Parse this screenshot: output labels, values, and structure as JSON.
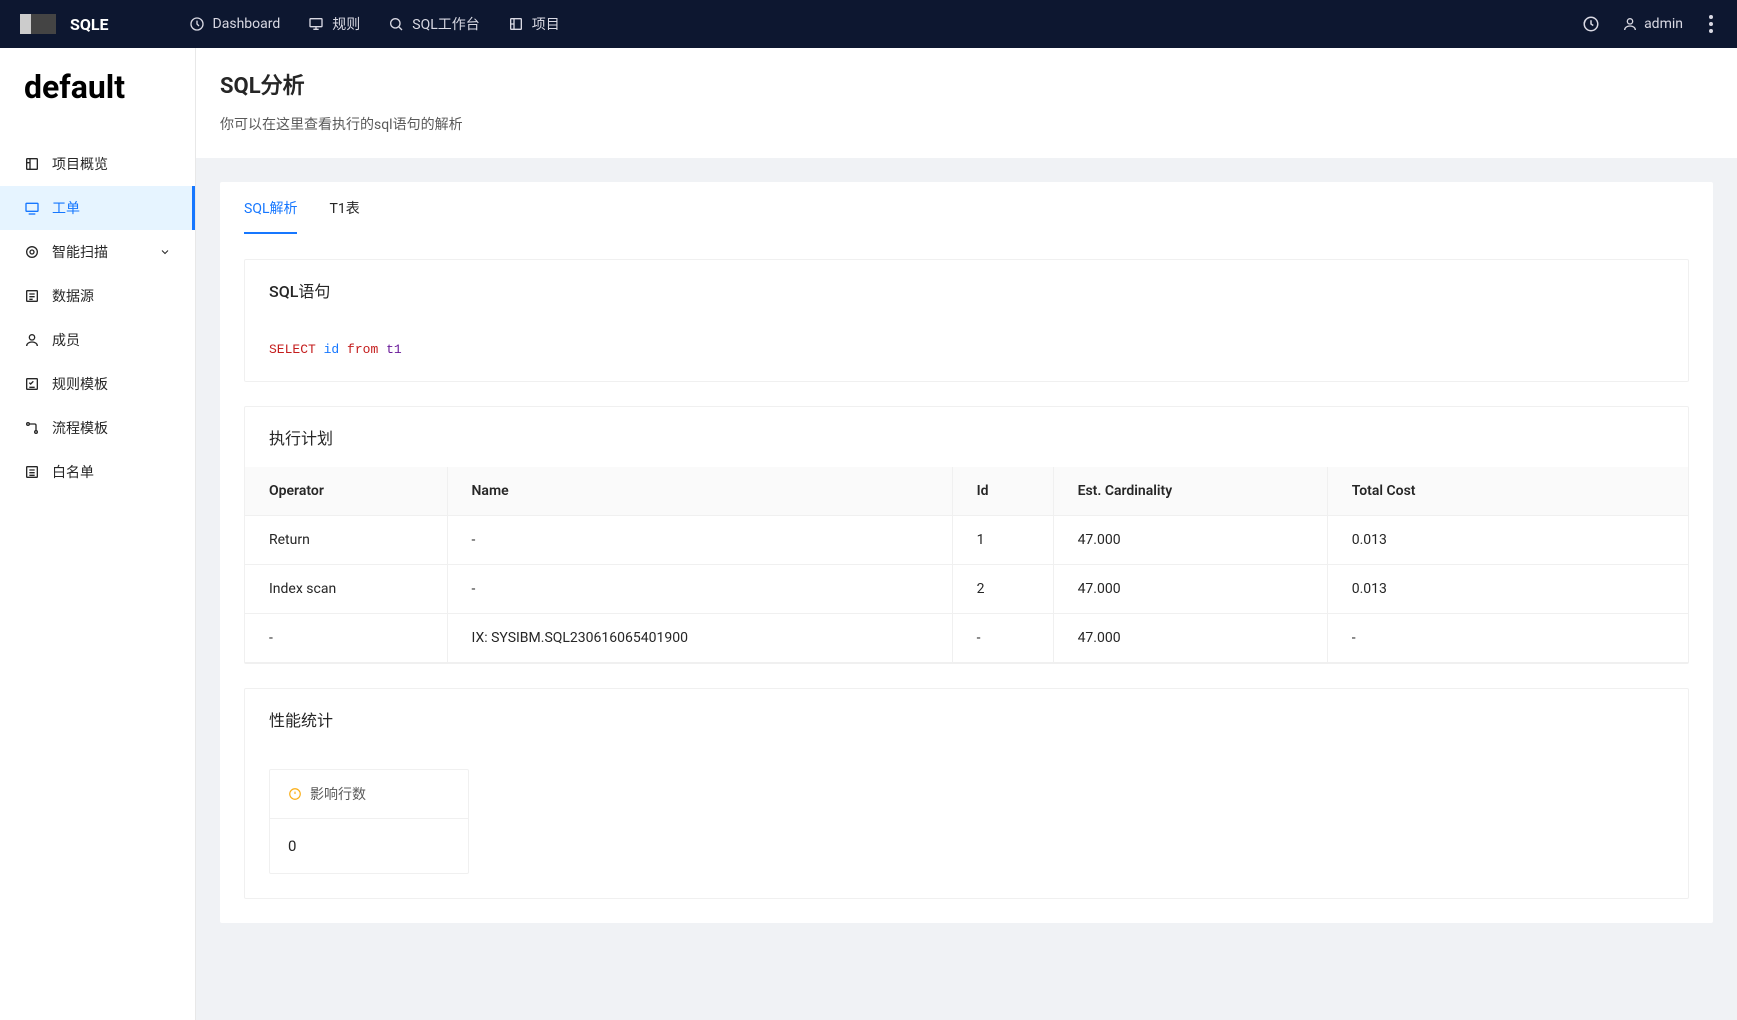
{
  "topbar": {
    "brand": "SQLE",
    "nav": [
      {
        "label": "Dashboard"
      },
      {
        "label": "规则"
      },
      {
        "label": "SQL工作台"
      },
      {
        "label": "项目"
      }
    ],
    "user": "admin"
  },
  "sidebar": {
    "workspace": "default",
    "items": [
      {
        "label": "项目概览"
      },
      {
        "label": "工单"
      },
      {
        "label": "智能扫描"
      },
      {
        "label": "数据源"
      },
      {
        "label": "成员"
      },
      {
        "label": "规则模板"
      },
      {
        "label": "流程模板"
      },
      {
        "label": "白名单"
      }
    ]
  },
  "page": {
    "title": "SQL分析",
    "subtitle": "你可以在这里查看执行的sql语句的解析"
  },
  "tabs": [
    {
      "label": "SQL解析"
    },
    {
      "label": "T1表"
    }
  ],
  "sql_section": {
    "title": "SQL语句",
    "tokens": {
      "select": "SELECT",
      "ident": "id",
      "from": "from",
      "table": "t1"
    }
  },
  "plan_section": {
    "title": "执行计划",
    "columns": {
      "operator": "Operator",
      "name": "Name",
      "id": "Id",
      "cardinality": "Est. Cardinality",
      "cost": "Total Cost"
    },
    "rows": [
      {
        "operator": "Return",
        "name": "-",
        "id": "1",
        "cardinality": "47.000",
        "cost": "0.013"
      },
      {
        "operator": "Index scan",
        "name": "-",
        "id": "2",
        "cardinality": "47.000",
        "cost": "0.013"
      },
      {
        "operator": "-",
        "name": "IX: SYSIBM.SQL230616065401900",
        "id": "-",
        "cardinality": "47.000",
        "cost": "-"
      }
    ]
  },
  "stats_section": {
    "title": "性能统计",
    "cards": [
      {
        "title": "影响行数",
        "value": "0"
      }
    ]
  }
}
